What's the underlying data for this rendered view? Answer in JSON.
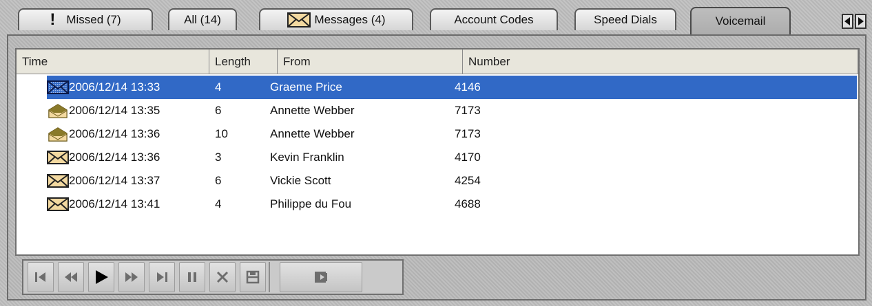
{
  "tabs": [
    {
      "label": "Missed (7)",
      "icon": "exclamation-icon"
    },
    {
      "label": "All (14)"
    },
    {
      "label": "Messages (4)",
      "icon": "envelope-icon"
    },
    {
      "label": "Account Codes"
    },
    {
      "label": "Speed Dials"
    },
    {
      "label": "Voicemail",
      "active": true
    }
  ],
  "columns": [
    "Time",
    "Length",
    "From",
    "Number"
  ],
  "rows": [
    {
      "time": "2006/12/14 13:33",
      "length": "4",
      "from": "Graeme Price",
      "number": "4146",
      "icon": "envelope-selected-icon",
      "selected": true
    },
    {
      "time": "2006/12/14 13:35",
      "length": "6",
      "from": "Annette Webber",
      "number": "7173",
      "icon": "open-envelope-icon"
    },
    {
      "time": "2006/12/14 13:36",
      "length": "10",
      "from": "Annette Webber",
      "number": "7173",
      "icon": "open-envelope-icon"
    },
    {
      "time": "2006/12/14 13:36",
      "length": "3",
      "from": "Kevin Franklin",
      "number": "4170",
      "icon": "envelope-icon"
    },
    {
      "time": "2006/12/14 13:37",
      "length": "6",
      "from": "Vickie Scott",
      "number": "4254",
      "icon": "envelope-icon"
    },
    {
      "time": "2006/12/14 13:41",
      "length": "4",
      "from": "Philippe du Fou",
      "number": "4688",
      "icon": "envelope-icon"
    }
  ],
  "toolbar_buttons": [
    "skip-to-start-icon",
    "rewind-icon",
    "play-icon",
    "fast-forward-icon",
    "skip-to-end-icon",
    "pause-icon",
    "delete-icon",
    "save-icon",
    "forward-to-mailbox-icon"
  ],
  "colors": {
    "selection": "#3169c6",
    "envelope": "#f3d9a0",
    "open_envelope": "#8a7a2a",
    "panel": "#b8b8b8"
  }
}
